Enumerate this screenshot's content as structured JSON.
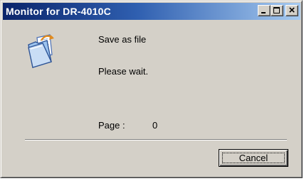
{
  "window": {
    "title": "Monitor for DR-4010C",
    "minimize_icon": "minimize-icon",
    "maximize_icon": "maximize-icon",
    "close_icon": "close-icon"
  },
  "dialog": {
    "icon": "folder-open-icon",
    "status_line_1": "Save as file",
    "status_line_2": "Please wait.",
    "page_label": "Page :",
    "page_number": "0"
  },
  "buttons": {
    "cancel_label": "Cancel"
  },
  "colors": {
    "title_gradient_start": "#0a246a",
    "title_gradient_end": "#a6caf0",
    "dialog_bg": "#d4d0c8"
  }
}
